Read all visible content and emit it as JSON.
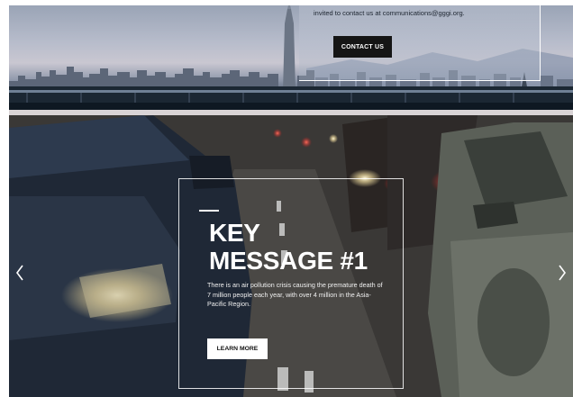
{
  "contact": {
    "text": "invited to contact us at communications@gggi.org.",
    "button_label": "CONTACT US"
  },
  "slide": {
    "title_line1": "KEY",
    "title_line2": "MESSAGE #1",
    "body": "There is an air pollution crisis causing the premature death of 7 million people each year, with over 4 million in the Asia-Pacific Region.",
    "button_label": "LEARN MORE"
  },
  "icons": {
    "prev": "chevron-left-icon",
    "next": "chevron-right-icon"
  },
  "colors": {
    "contact_button_bg": "#151515",
    "learn_button_bg": "#ffffff",
    "frame": "#ffffff"
  }
}
